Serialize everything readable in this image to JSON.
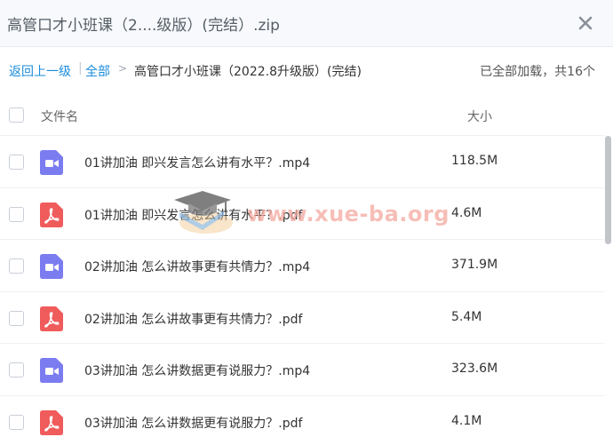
{
  "window": {
    "title": "高管口才小班课（2....级版）(完结）.zip",
    "close_icon": "close-icon"
  },
  "breadcrumb": {
    "back": "返回上一级",
    "separator": "|",
    "all": "全部",
    "arrow": ">",
    "current": "高管口才小班课（2022.8升级版）(完结)",
    "status": "已全部加载，共16个"
  },
  "header": {
    "name": "文件名",
    "size": "大小"
  },
  "files": [
    {
      "name": "01讲加油 即兴发言怎么讲有水平？.mp4",
      "size": "118.5M",
      "type": "video"
    },
    {
      "name": "01讲加油 即兴发言怎么讲有水平？.pdf",
      "size": "4.6M",
      "type": "pdf"
    },
    {
      "name": "02讲加油 怎么讲故事更有共情力？.mp4",
      "size": "371.9M",
      "type": "video"
    },
    {
      "name": "02讲加油 怎么讲故事更有共情力？.pdf",
      "size": "5.4M",
      "type": "pdf"
    },
    {
      "name": "03讲加油 怎么讲数据更有说服力？.mp4",
      "size": "323.6M",
      "type": "video"
    },
    {
      "name": "03讲加油 怎么讲数据更有说服力？.pdf",
      "size": "4.1M",
      "type": "pdf"
    }
  ],
  "watermark": {
    "text": "www.xue-ba.org"
  },
  "colors": {
    "link": "#1a8cdb",
    "video_icon": "#7b7cf0",
    "pdf_icon": "#f05b5b"
  }
}
